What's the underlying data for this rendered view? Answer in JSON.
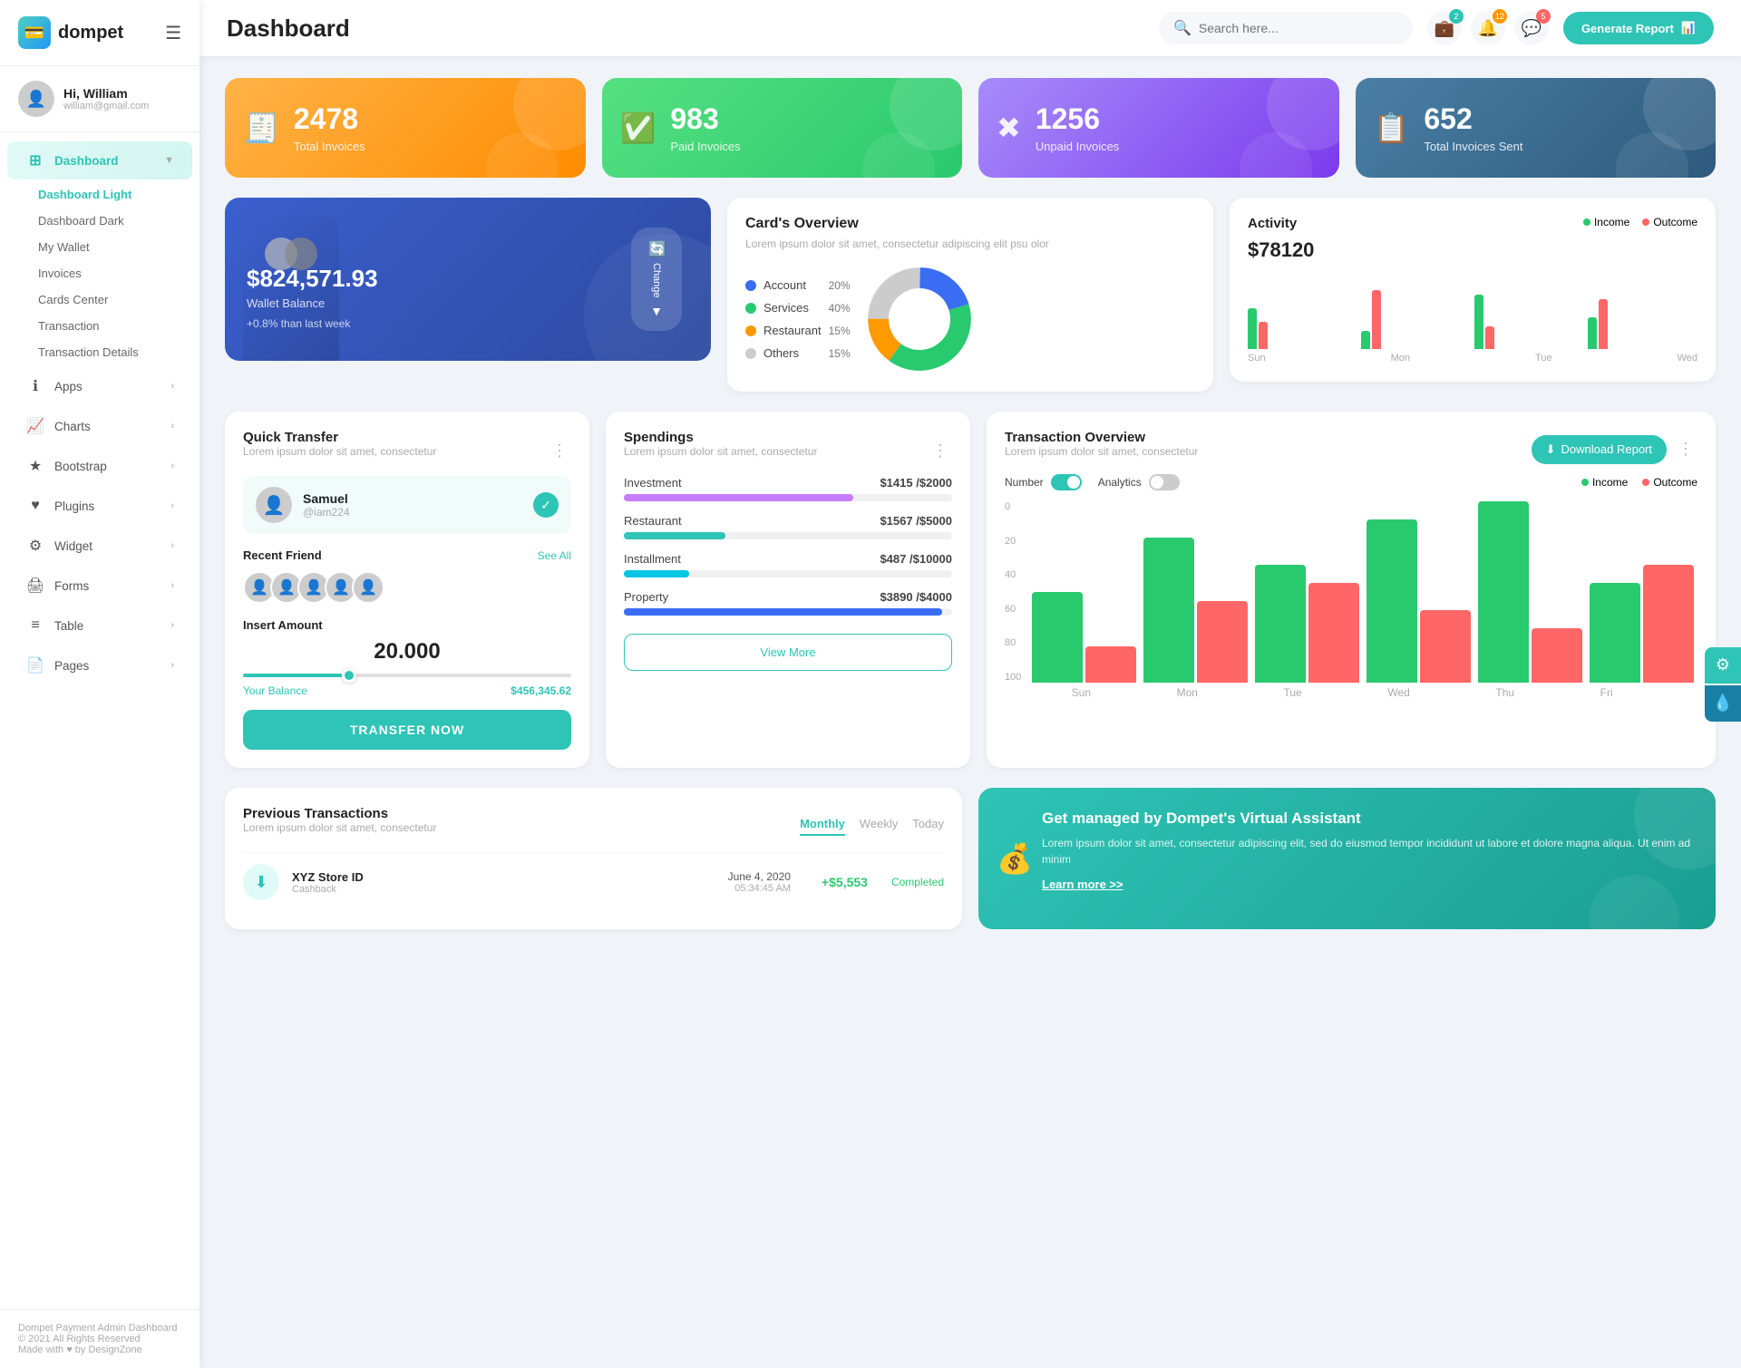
{
  "app": {
    "logo_text": "dompet",
    "page_title": "Dashboard"
  },
  "user": {
    "greeting": "Hi, William",
    "email": "william@gmail.com"
  },
  "header": {
    "search_placeholder": "Search here...",
    "notifications_badge": "2",
    "bell_badge": "12",
    "chat_badge": "5",
    "generate_btn": "Generate Report"
  },
  "stat_cards": [
    {
      "icon": "🧾",
      "number": "2478",
      "label": "Total Invoices",
      "style": "orange"
    },
    {
      "icon": "✅",
      "number": "983",
      "label": "Paid Invoices",
      "style": "green"
    },
    {
      "icon": "✖",
      "number": "1256",
      "label": "Unpaid Invoices",
      "style": "purple"
    },
    {
      "icon": "📋",
      "number": "652",
      "label": "Total Invoices Sent",
      "style": "slate"
    }
  ],
  "wallet": {
    "amount": "$824,571.93",
    "label": "Wallet Balance",
    "change": "+0.8% than last week",
    "change_btn": "Change"
  },
  "cards_overview": {
    "title": "Card's Overview",
    "subtitle": "Lorem ipsum dolor sit amet, consectetur adipiscing elit psu olor",
    "legend": [
      {
        "label": "Account",
        "pct": "20%",
        "color": "#3a6cf4"
      },
      {
        "label": "Services",
        "pct": "40%",
        "color": "#29c96e"
      },
      {
        "label": "Restaurant",
        "pct": "15%",
        "color": "#ff9900"
      },
      {
        "label": "Others",
        "pct": "15%",
        "color": "#ccc"
      }
    ],
    "pie_data": [
      {
        "label": "Account",
        "value": 20,
        "color": "#3a6cf4"
      },
      {
        "label": "Services",
        "value": 40,
        "color": "#29c96e"
      },
      {
        "label": "Restaurant",
        "value": 15,
        "color": "#ff9900"
      },
      {
        "label": "Others",
        "value": 25,
        "color": "#ccc"
      }
    ]
  },
  "activity": {
    "title": "Activity",
    "amount": "$78120",
    "income_label": "Income",
    "outcome_label": "Outcome",
    "bars": [
      {
        "day": "Sun",
        "income": 45,
        "outcome": 30
      },
      {
        "day": "Mon",
        "income": 20,
        "outcome": 65
      },
      {
        "day": "Tue",
        "income": 60,
        "outcome": 25
      },
      {
        "day": "Wed",
        "income": 35,
        "outcome": 55
      }
    ]
  },
  "quick_transfer": {
    "title": "Quick Transfer",
    "subtitle": "Lorem ipsum dolor sit amet, consectetur",
    "contact_name": "Samuel",
    "contact_user": "@iam224",
    "recent_label": "Recent Friend",
    "see_all": "See All",
    "insert_amount_label": "Insert Amount",
    "amount": "20.000",
    "balance_label": "Your Balance",
    "balance_value": "$456,345.62",
    "transfer_btn": "TRANSFER NOW"
  },
  "spendings": {
    "title": "Spendings",
    "subtitle": "Lorem ipsum dolor sit amet, consectetur",
    "items": [
      {
        "label": "Investment",
        "spent": "$1415",
        "total": "$2000",
        "pct": 70,
        "color": "#c77dff"
      },
      {
        "label": "Restaurant",
        "spent": "$1567",
        "total": "$5000",
        "pct": 31,
        "color": "#2ec4b6"
      },
      {
        "label": "Installment",
        "spent": "$487",
        "total": "$10000",
        "pct": 20,
        "color": "#00c5e3"
      },
      {
        "label": "Property",
        "spent": "$3890",
        "total": "$4000",
        "pct": 97,
        "color": "#3a6cf4"
      }
    ],
    "view_more": "View More"
  },
  "transaction_overview": {
    "title": "Transaction Overview",
    "subtitle": "Lorem ipsum dolor sit amet, consectetur",
    "number_toggle": "Number",
    "analytics_toggle": "Analytics",
    "download_btn": "Download Report",
    "income_label": "Income",
    "outcome_label": "Outcome",
    "bars": [
      {
        "day": "Sun",
        "income": 50,
        "outcome": 20
      },
      {
        "day": "Mon",
        "income": 80,
        "outcome": 45
      },
      {
        "day": "Tue",
        "income": 65,
        "outcome": 55
      },
      {
        "day": "Wed",
        "income": 90,
        "outcome": 40
      },
      {
        "day": "Thu",
        "income": 100,
        "outcome": 30
      },
      {
        "day": "Fri",
        "income": 55,
        "outcome": 65
      }
    ],
    "y_labels": [
      "0",
      "20",
      "40",
      "60",
      "80",
      "100"
    ]
  },
  "prev_transactions": {
    "title": "Previous Transactions",
    "subtitle": "Lorem ipsum dolor sit amet, consectetur",
    "tabs": [
      "Monthly",
      "Weekly",
      "Today"
    ],
    "active_tab": "Monthly",
    "rows": [
      {
        "name": "XYZ Store ID",
        "type": "Cashback",
        "date": "June 4, 2020",
        "time": "05:34:45 AM",
        "amount": "+$5,553",
        "status": "Completed"
      }
    ]
  },
  "virtual_assistant": {
    "title": "Get managed by Dompet's Virtual Assistant",
    "desc": "Lorem ipsum dolor sit amet, consectetur adipiscing elit, sed do eiusmod tempor incididunt ut labore et dolore magna aliqua. Ut enim ad minim",
    "link": "Learn more >>"
  },
  "sidebar": {
    "nav_items": [
      {
        "id": "dashboard",
        "label": "Dashboard",
        "icon": "⊞",
        "active": true,
        "has_arrow": true
      },
      {
        "id": "apps",
        "label": "Apps",
        "icon": "ℹ",
        "active": false,
        "has_arrow": true
      },
      {
        "id": "charts",
        "label": "Charts",
        "icon": "📈",
        "active": false,
        "has_arrow": true
      },
      {
        "id": "bootstrap",
        "label": "Bootstrap",
        "icon": "★",
        "active": false,
        "has_arrow": true
      },
      {
        "id": "plugins",
        "label": "Plugins",
        "icon": "♥",
        "active": false,
        "has_arrow": true
      },
      {
        "id": "widget",
        "label": "Widget",
        "icon": "⚙",
        "active": false,
        "has_arrow": true
      },
      {
        "id": "forms",
        "label": "Forms",
        "icon": "🖨",
        "active": false,
        "has_arrow": true
      },
      {
        "id": "table",
        "label": "Table",
        "icon": "≡",
        "active": false,
        "has_arrow": true
      },
      {
        "id": "pages",
        "label": "Pages",
        "icon": "📄",
        "active": false,
        "has_arrow": true
      }
    ],
    "sub_items": [
      {
        "label": "Dashboard Light",
        "active": true
      },
      {
        "label": "Dashboard Dark",
        "active": false
      },
      {
        "label": "My Wallet",
        "active": false
      },
      {
        "label": "Invoices",
        "active": false
      },
      {
        "label": "Cards Center",
        "active": false
      },
      {
        "label": "Transaction",
        "active": false
      },
      {
        "label": "Transaction Details",
        "active": false
      }
    ],
    "footer_line1": "Dompet Payment Admin Dashboard",
    "footer_line2": "© 2021 All Rights Reserved",
    "footer_line3": "Made with ♥ by DesignZone"
  }
}
